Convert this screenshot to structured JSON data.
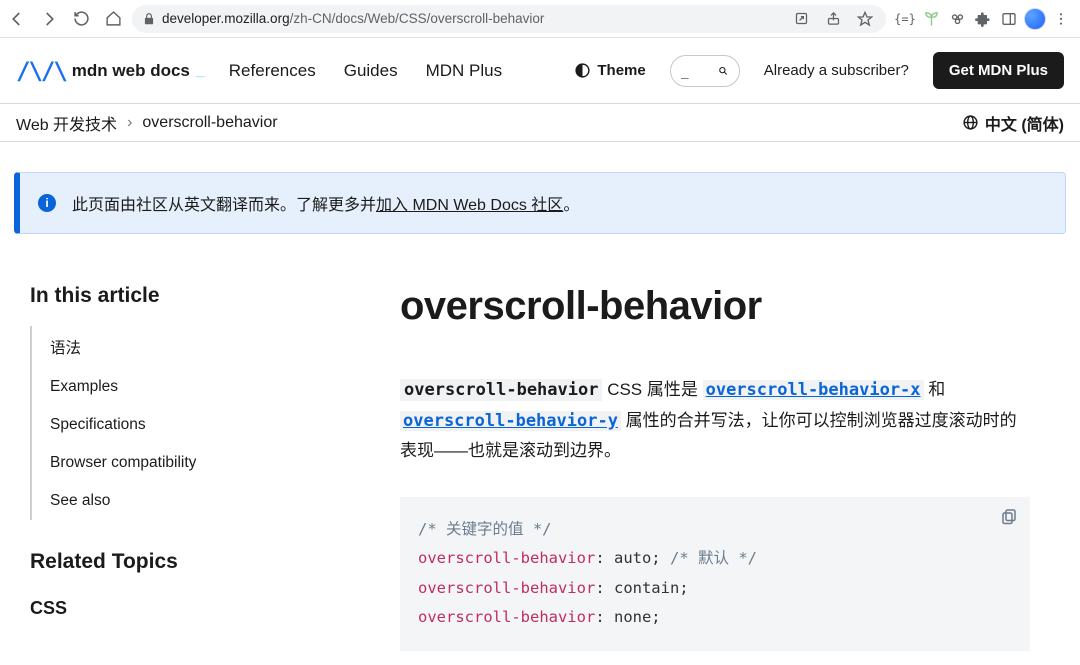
{
  "browser": {
    "url_host": "developer.mozilla.org",
    "url_path": "/zh-CN/docs/Web/CSS/overscroll-behavior"
  },
  "header": {
    "logo_text": "mdn web docs",
    "cursor": "_",
    "nav": {
      "references": "References",
      "guides": "Guides",
      "plus": "MDN Plus"
    },
    "theme": "Theme",
    "search_placeholder": "_",
    "subscriber": "Already a subscriber?",
    "get_plus": "Get MDN Plus"
  },
  "breadcrumb": {
    "root": "Web 开发技术",
    "page": "overscroll-behavior",
    "lang": "中文 (简体)"
  },
  "banner": {
    "part1": "此页面由社区从英文翻译而来。了解更多并",
    "part_link": "加入 MDN Web Docs 社区",
    "part2": "。"
  },
  "sidebar": {
    "in_this": "In this article",
    "toc": [
      "语法",
      "Examples",
      "Specifications",
      "Browser compatibility",
      "See also"
    ],
    "related": "Related Topics",
    "css": "CSS"
  },
  "article": {
    "title": "overscroll-behavior",
    "code1": "overscroll-behavior",
    "t1": " CSS 属性是 ",
    "link1": "overscroll-behavior-x",
    "t2": " 和 ",
    "link2": "overscroll-behavior-y",
    "t3": " 属性的合并写法，让你可以控制浏览器过度滚动时的表现——也就是滚动到边界。"
  },
  "code": {
    "cm1": "/* 关键字的值 */",
    "p": "overscroll-behavior",
    "v1": "auto;",
    "cm_inline": "/* 默认 */",
    "v2": "contain;",
    "v3": "none;"
  }
}
